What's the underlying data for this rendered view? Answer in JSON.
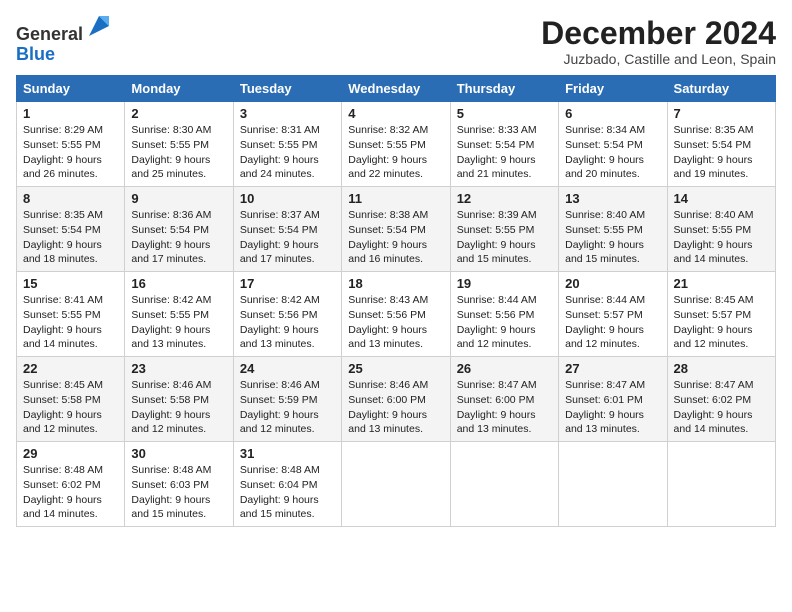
{
  "header": {
    "logo_line1": "General",
    "logo_line2": "Blue",
    "month": "December 2024",
    "location": "Juzbado, Castille and Leon, Spain"
  },
  "days_of_week": [
    "Sunday",
    "Monday",
    "Tuesday",
    "Wednesday",
    "Thursday",
    "Friday",
    "Saturday"
  ],
  "weeks": [
    [
      {
        "day": "1",
        "sunrise": "8:29 AM",
        "sunset": "5:55 PM",
        "daylight": "9 hours and 26 minutes."
      },
      {
        "day": "2",
        "sunrise": "8:30 AM",
        "sunset": "5:55 PM",
        "daylight": "9 hours and 25 minutes."
      },
      {
        "day": "3",
        "sunrise": "8:31 AM",
        "sunset": "5:55 PM",
        "daylight": "9 hours and 24 minutes."
      },
      {
        "day": "4",
        "sunrise": "8:32 AM",
        "sunset": "5:55 PM",
        "daylight": "9 hours and 22 minutes."
      },
      {
        "day": "5",
        "sunrise": "8:33 AM",
        "sunset": "5:54 PM",
        "daylight": "9 hours and 21 minutes."
      },
      {
        "day": "6",
        "sunrise": "8:34 AM",
        "sunset": "5:54 PM",
        "daylight": "9 hours and 20 minutes."
      },
      {
        "day": "7",
        "sunrise": "8:35 AM",
        "sunset": "5:54 PM",
        "daylight": "9 hours and 19 minutes."
      }
    ],
    [
      {
        "day": "8",
        "sunrise": "8:35 AM",
        "sunset": "5:54 PM",
        "daylight": "9 hours and 18 minutes."
      },
      {
        "day": "9",
        "sunrise": "8:36 AM",
        "sunset": "5:54 PM",
        "daylight": "9 hours and 17 minutes."
      },
      {
        "day": "10",
        "sunrise": "8:37 AM",
        "sunset": "5:54 PM",
        "daylight": "9 hours and 17 minutes."
      },
      {
        "day": "11",
        "sunrise": "8:38 AM",
        "sunset": "5:54 PM",
        "daylight": "9 hours and 16 minutes."
      },
      {
        "day": "12",
        "sunrise": "8:39 AM",
        "sunset": "5:55 PM",
        "daylight": "9 hours and 15 minutes."
      },
      {
        "day": "13",
        "sunrise": "8:40 AM",
        "sunset": "5:55 PM",
        "daylight": "9 hours and 15 minutes."
      },
      {
        "day": "14",
        "sunrise": "8:40 AM",
        "sunset": "5:55 PM",
        "daylight": "9 hours and 14 minutes."
      }
    ],
    [
      {
        "day": "15",
        "sunrise": "8:41 AM",
        "sunset": "5:55 PM",
        "daylight": "9 hours and 14 minutes."
      },
      {
        "day": "16",
        "sunrise": "8:42 AM",
        "sunset": "5:55 PM",
        "daylight": "9 hours and 13 minutes."
      },
      {
        "day": "17",
        "sunrise": "8:42 AM",
        "sunset": "5:56 PM",
        "daylight": "9 hours and 13 minutes."
      },
      {
        "day": "18",
        "sunrise": "8:43 AM",
        "sunset": "5:56 PM",
        "daylight": "9 hours and 13 minutes."
      },
      {
        "day": "19",
        "sunrise": "8:44 AM",
        "sunset": "5:56 PM",
        "daylight": "9 hours and 12 minutes."
      },
      {
        "day": "20",
        "sunrise": "8:44 AM",
        "sunset": "5:57 PM",
        "daylight": "9 hours and 12 minutes."
      },
      {
        "day": "21",
        "sunrise": "8:45 AM",
        "sunset": "5:57 PM",
        "daylight": "9 hours and 12 minutes."
      }
    ],
    [
      {
        "day": "22",
        "sunrise": "8:45 AM",
        "sunset": "5:58 PM",
        "daylight": "9 hours and 12 minutes."
      },
      {
        "day": "23",
        "sunrise": "8:46 AM",
        "sunset": "5:58 PM",
        "daylight": "9 hours and 12 minutes."
      },
      {
        "day": "24",
        "sunrise": "8:46 AM",
        "sunset": "5:59 PM",
        "daylight": "9 hours and 12 minutes."
      },
      {
        "day": "25",
        "sunrise": "8:46 AM",
        "sunset": "6:00 PM",
        "daylight": "9 hours and 13 minutes."
      },
      {
        "day": "26",
        "sunrise": "8:47 AM",
        "sunset": "6:00 PM",
        "daylight": "9 hours and 13 minutes."
      },
      {
        "day": "27",
        "sunrise": "8:47 AM",
        "sunset": "6:01 PM",
        "daylight": "9 hours and 13 minutes."
      },
      {
        "day": "28",
        "sunrise": "8:47 AM",
        "sunset": "6:02 PM",
        "daylight": "9 hours and 14 minutes."
      }
    ],
    [
      {
        "day": "29",
        "sunrise": "8:48 AM",
        "sunset": "6:02 PM",
        "daylight": "9 hours and 14 minutes."
      },
      {
        "day": "30",
        "sunrise": "8:48 AM",
        "sunset": "6:03 PM",
        "daylight": "9 hours and 15 minutes."
      },
      {
        "day": "31",
        "sunrise": "8:48 AM",
        "sunset": "6:04 PM",
        "daylight": "9 hours and 15 minutes."
      },
      null,
      null,
      null,
      null
    ]
  ]
}
